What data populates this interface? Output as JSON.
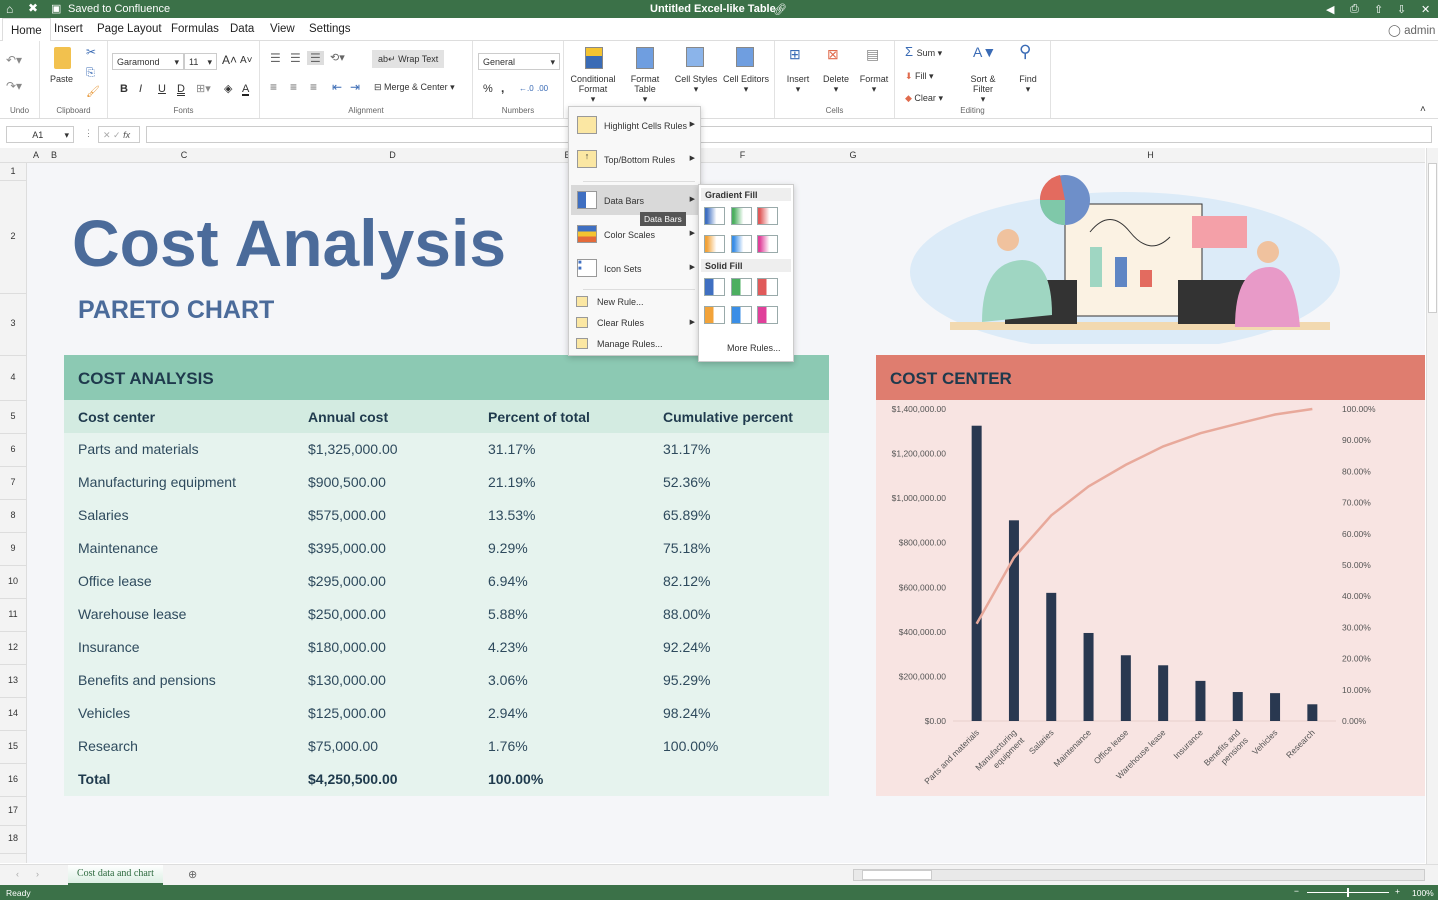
{
  "titlebar": {
    "saved": "Saved to Confluence",
    "title": "Untitled Excel-like Table"
  },
  "tabs": [
    "Home",
    "Insert",
    "Page Layout",
    "Formulas",
    "Data",
    "View",
    "Settings"
  ],
  "user": "admin",
  "ribbon": {
    "undo_group": "Undo",
    "clipboard_group": "Clipboard",
    "paste": "Paste",
    "font_name": "Garamond",
    "font_size": "11",
    "fonts_group": "Fonts",
    "wrap_text": "Wrap Text",
    "merge_center": "Merge & Center",
    "alignment_group": "Alignment",
    "number_format": "General",
    "numbers_group": "Numbers",
    "conditional_format": "Conditional Format",
    "format_table": "Format Table",
    "cell_styles": "Cell Styles",
    "cell_editors": "Cell Editors",
    "insert": "Insert",
    "delete": "Delete",
    "format": "Format",
    "cells_group": "Cells",
    "sum": "Sum",
    "fill": "Fill",
    "clear": "Clear",
    "sort_filter": "Sort & Filter",
    "find": "Find",
    "editing_group": "Editing"
  },
  "formula_bar": {
    "cell_ref": "A1",
    "fx": "fx",
    "value": ""
  },
  "columns": [
    "A",
    "B",
    "C",
    "D",
    "E",
    "F",
    "G",
    "H"
  ],
  "rows": [
    "1",
    "2",
    "3",
    "4",
    "5",
    "6",
    "7",
    "8",
    "9",
    "10",
    "11",
    "12",
    "13",
    "14",
    "15",
    "16",
    "17",
    "18"
  ],
  "sheet": {
    "title": "Cost Analysis",
    "subtitle": "PARETO CHART",
    "table_title": "COST ANALYSIS",
    "headers": [
      "Cost center",
      "Annual cost",
      "Percent of total",
      "Cumulative percent"
    ],
    "data": [
      [
        "Parts and materials",
        "$1,325,000.00",
        "31.17%",
        "31.17%"
      ],
      [
        "Manufacturing equipment",
        "$900,500.00",
        "21.19%",
        "52.36%"
      ],
      [
        "Salaries",
        "$575,000.00",
        "13.53%",
        "65.89%"
      ],
      [
        "Maintenance",
        "$395,000.00",
        "9.29%",
        "75.18%"
      ],
      [
        "Office lease",
        "$295,000.00",
        "6.94%",
        "82.12%"
      ],
      [
        "Warehouse lease",
        "$250,000.00",
        "5.88%",
        "88.00%"
      ],
      [
        "Insurance",
        "$180,000.00",
        "4.23%",
        "92.24%"
      ],
      [
        "Benefits and pensions",
        "$130,000.00",
        "3.06%",
        "95.29%"
      ],
      [
        "Vehicles",
        "$125,000.00",
        "2.94%",
        "98.24%"
      ],
      [
        "Research",
        "$75,000.00",
        "1.76%",
        "100.00%"
      ]
    ],
    "total": [
      "Total",
      "$4,250,500.00",
      "100.00%"
    ],
    "chart_title": "COST CENTER"
  },
  "chart_data": {
    "type": "bar",
    "title": "COST CENTER",
    "categories": [
      "Parts and materials",
      "Manufacturing equipment",
      "Salaries",
      "Maintenance",
      "Office lease",
      "Warehouse lease",
      "Insurance",
      "Benefits and pensions",
      "Vehicles",
      "Research"
    ],
    "series": [
      {
        "name": "Annual cost",
        "type": "bar",
        "axis": "left",
        "values": [
          1325000,
          900500,
          575000,
          395000,
          295000,
          250000,
          180000,
          130000,
          125000,
          75000
        ]
      },
      {
        "name": "Cumulative percent",
        "type": "line",
        "axis": "right",
        "values": [
          31.17,
          52.36,
          65.89,
          75.18,
          82.12,
          88.0,
          92.24,
          95.29,
          98.24,
          100.0
        ]
      }
    ],
    "ylim": [
      0,
      1400000
    ],
    "y2lim": [
      0,
      100
    ],
    "yticks": [
      "$0.00",
      "$200,000.00",
      "$400,000.00",
      "$600,000.00",
      "$800,000.00",
      "$1,000,000.00",
      "$1,200,000.00",
      "$1,400,000.00"
    ],
    "y2ticks": [
      "0.00%",
      "10.00%",
      "20.00%",
      "30.00%",
      "40.00%",
      "50.00%",
      "60.00%",
      "70.00%",
      "80.00%",
      "90.00%",
      "100.00%"
    ],
    "colors": {
      "bar": "#293850",
      "line": "#e8a99b"
    }
  },
  "menu": {
    "items": [
      "Highlight Cells Rules",
      "Top/Bottom Rules",
      "Data Bars",
      "Color Scales",
      "Icon Sets",
      "New Rule...",
      "Clear Rules",
      "Manage Rules..."
    ],
    "tooltip": "Data Bars",
    "gradient_fill": "Gradient Fill",
    "solid_fill": "Solid Fill",
    "more_rules": "More Rules...",
    "swatch_colors": [
      "#3f6fc1",
      "#4caf60",
      "#e05a5a",
      "#f2a33a",
      "#3a8ee6",
      "#e0409a"
    ]
  },
  "sheet_tab": "Cost data and chart",
  "status": {
    "ready": "Ready",
    "zoom": "100%"
  }
}
